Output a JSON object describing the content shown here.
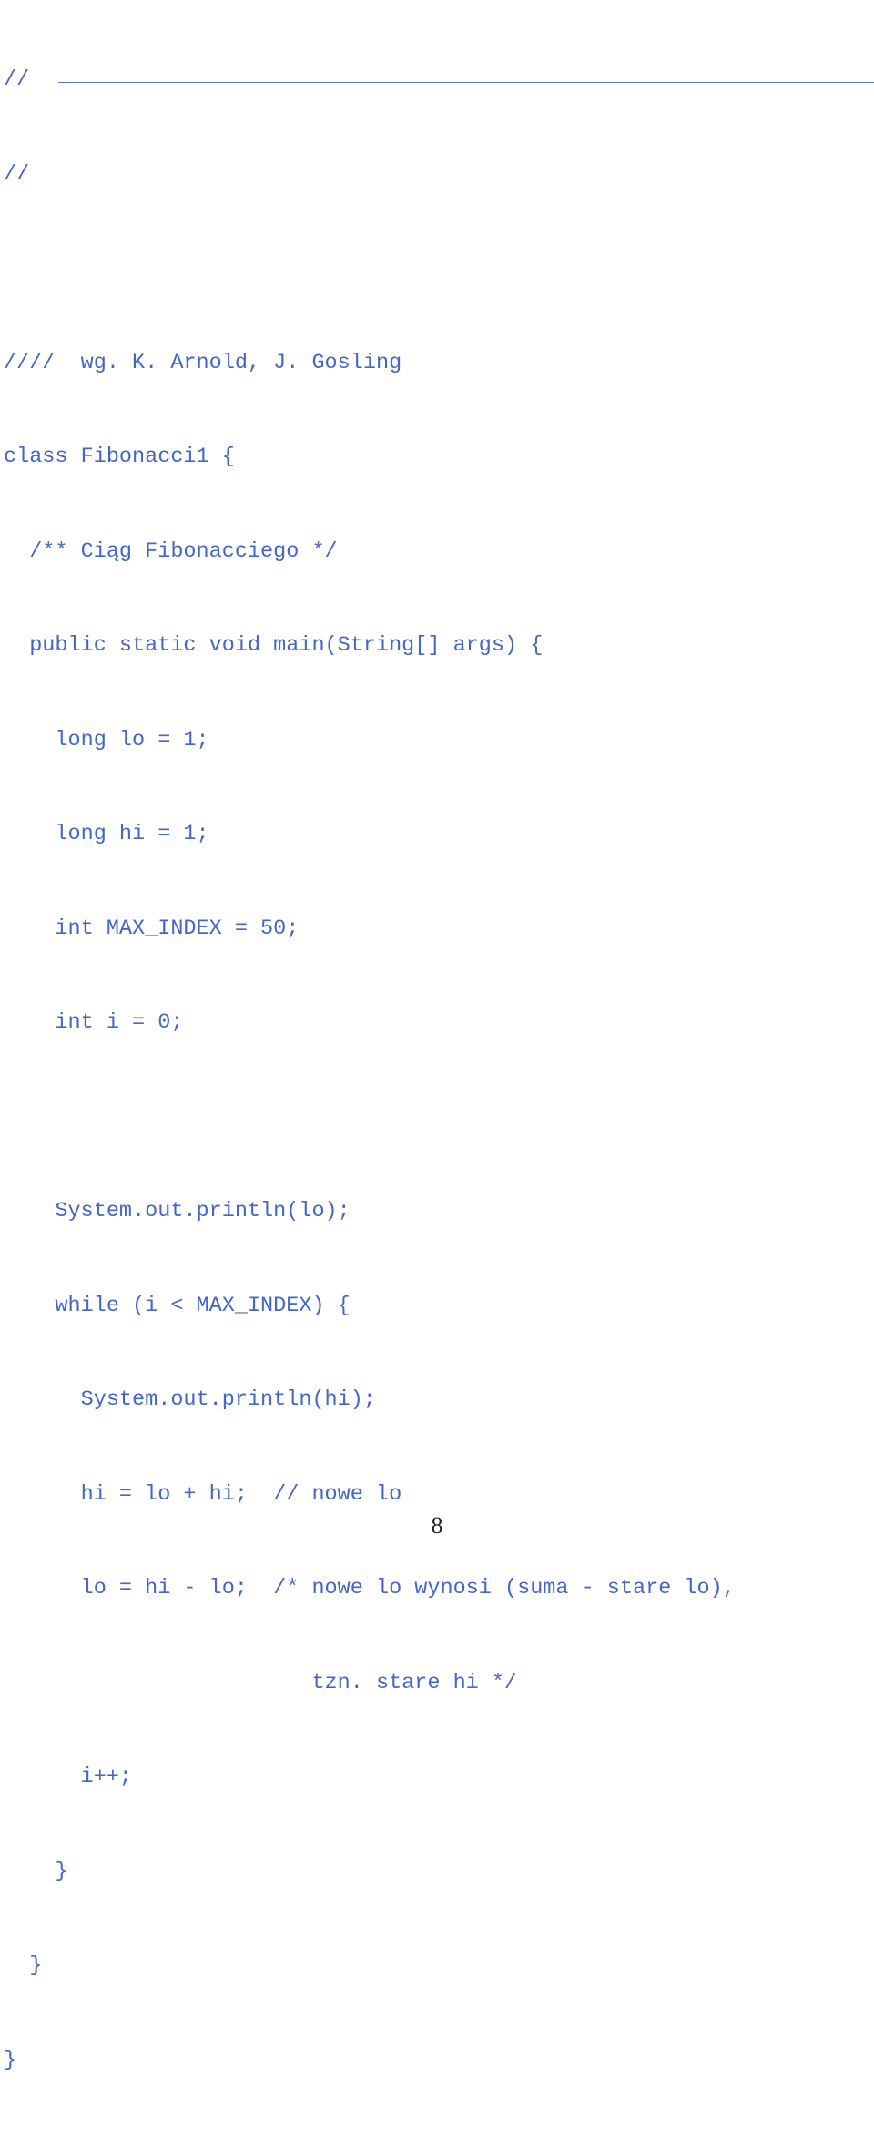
{
  "document": {
    "code_lines": [
      "//",
      "//",
      "",
      "////  wg. K. Arnold, J. Gosling",
      "class Fibonacci1 {",
      "  /** Ciąg Fibonacciego */",
      "  public static void main(String[] args) {",
      "    long lo = 1;",
      "    long hi = 1;",
      "    int MAX_INDEX = 50;",
      "    int i = 0;",
      "",
      "    System.out.println(lo);",
      "    while (i < MAX_INDEX) {",
      "      System.out.println(hi);",
      "      hi = lo + hi;  // nowe lo",
      "      lo = hi - lo;  /* nowe lo wynosi (suma - stare lo),",
      "                        tzn. stare hi */",
      "      i++;",
      "    }",
      "  }",
      "}"
    ],
    "page_number": "8",
    "text_color": "#4466c4"
  }
}
